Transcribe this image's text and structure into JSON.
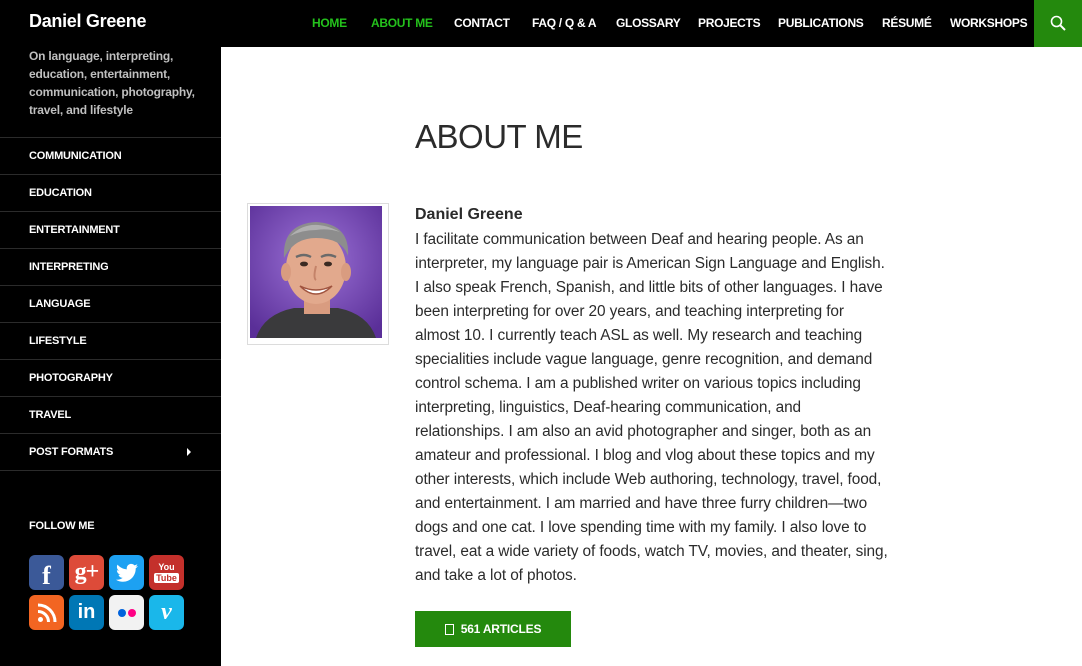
{
  "site": {
    "title": "Daniel Greene",
    "tagline": "On language, interpreting, education, entertainment, communication, photography, travel, and lifestyle"
  },
  "nav": {
    "items": [
      {
        "label": "HOME",
        "active": true
      },
      {
        "label": "ABOUT ME",
        "active": true
      },
      {
        "label": "CONTACT",
        "active": false
      },
      {
        "label": "FAQ / Q & A",
        "active": false
      },
      {
        "label": "GLOSSARY",
        "active": false
      },
      {
        "label": "PROJECTS",
        "active": false
      },
      {
        "label": "PUBLICATIONS",
        "active": false
      },
      {
        "label": "RÉSUMÉ",
        "active": false
      },
      {
        "label": "WORKSHOPS",
        "active": false
      }
    ],
    "search_icon": "search-icon"
  },
  "sidebar": {
    "categories": [
      "COMMUNICATION",
      "EDUCATION",
      "ENTERTAINMENT",
      "INTERPRETING",
      "LANGUAGE",
      "LIFESTYLE",
      "PHOTOGRAPHY",
      "TRAVEL",
      "POST FORMATS"
    ],
    "follow_title": "FOLLOW ME",
    "social": [
      {
        "name": "facebook",
        "glyph": "f",
        "color": "#3b5998"
      },
      {
        "name": "google-plus",
        "glyph": "g+",
        "color": "#dd4b39"
      },
      {
        "name": "twitter",
        "glyph": "t",
        "color": "#1da1f2"
      },
      {
        "name": "youtube",
        "glyph": "You Tube",
        "color": "#c4302b"
      },
      {
        "name": "rss",
        "glyph": "rss",
        "color": "#f26522"
      },
      {
        "name": "linkedin",
        "glyph": "in",
        "color": "#0077b5"
      },
      {
        "name": "flickr",
        "glyph": "flickr",
        "color": "#f2f2f2"
      },
      {
        "name": "vimeo",
        "glyph": "v",
        "color": "#1ab7ea"
      }
    ]
  },
  "main": {
    "page_title": "ABOUT ME",
    "author_name": "Daniel Greene",
    "bio": "I facilitate communication between Deaf and hearing people. As an interpreter, my language pair is American Sign Language and English. I also speak French, Spanish, and little bits of other languages. I have been interpreting for over 20 years, and teaching interpreting for almost 10. I currently teach ASL as well. My research and teaching specialities include vague language, genre recognition, and demand control schema. I am a published writer on various topics including interpreting, linguistics, Deaf-hearing communication, and relationships. I am also an avid photographer and singer, both as an amateur and professional. I blog and vlog about these topics and my other interests, which include Web authoring, technology, travel, food, and entertainment. I am married and have three furry children—two dogs and one cat. I love spending time with my family. I also love to travel, eat a wide variety of foods, watch TV, movies, and theater, sing, and take a lot of photos.",
    "articles_button": "561 ARTICLES"
  },
  "colors": {
    "accent_green": "#24890d",
    "active_nav_green": "#24c11c",
    "sidebar_bg": "#000000"
  }
}
